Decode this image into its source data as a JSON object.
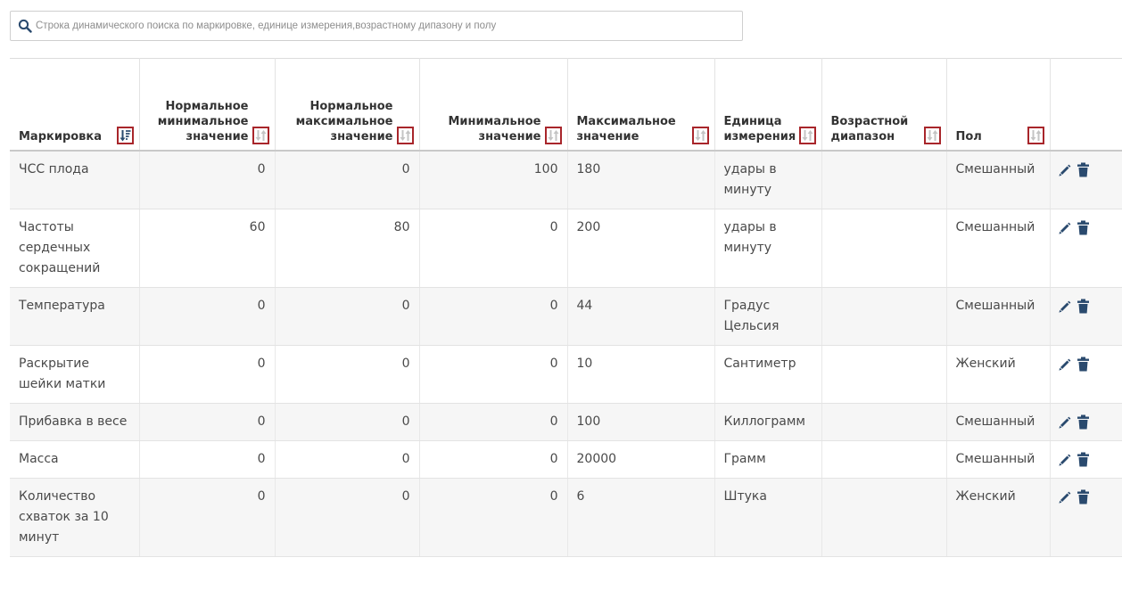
{
  "search": {
    "placeholder": "Строка динамического поиска по маркировке, единице измерения,возрастному дипазону и полу"
  },
  "colors": {
    "accent": "#2a4a6e",
    "sort_highlight": "#a8262b",
    "row_alt": "#f6f6f6"
  },
  "icons": {
    "search": "search-icon",
    "sort": "sort-icon",
    "edit": "pencil-icon",
    "delete": "trash-icon"
  },
  "columns": {
    "marking": "Маркировка",
    "normal_min": "Нормальное минимальное значение",
    "normal_max": "Нормальное максимальное значение",
    "min": "Минимальное значение",
    "max": "Максимальное значение",
    "unit": "Единица измерения",
    "age_range": "Возрастной диапазон",
    "sex": "Пол"
  },
  "rows": [
    {
      "marking": "ЧСС плода",
      "normal_min": "0",
      "normal_max": "0",
      "min": "100",
      "max": "180",
      "unit": "удары в минуту",
      "age_range": "",
      "sex": "Смешанный"
    },
    {
      "marking": "Частоты сердечных сокращений",
      "normal_min": "60",
      "normal_max": "80",
      "min": "0",
      "max": "200",
      "unit": "удары в минуту",
      "age_range": "",
      "sex": "Смешанный"
    },
    {
      "marking": "Температура",
      "normal_min": "0",
      "normal_max": "0",
      "min": "0",
      "max": "44",
      "unit": "Градус Цельсия",
      "age_range": "",
      "sex": "Смешанный"
    },
    {
      "marking": "Раскрытие шейки матки",
      "normal_min": "0",
      "normal_max": "0",
      "min": "0",
      "max": "10",
      "unit": "Сантиметр",
      "age_range": "",
      "sex": "Женский"
    },
    {
      "marking": "Прибавка в весе",
      "normal_min": "0",
      "normal_max": "0",
      "min": "0",
      "max": "100",
      "unit": "Киллограмм",
      "age_range": "",
      "sex": "Смешанный"
    },
    {
      "marking": "Масса",
      "normal_min": "0",
      "normal_max": "0",
      "min": "0",
      "max": "20000",
      "unit": "Грамм",
      "age_range": "",
      "sex": "Смешанный"
    },
    {
      "marking": "Количество схваток за 10 минут",
      "normal_min": "0",
      "normal_max": "0",
      "min": "0",
      "max": "6",
      "unit": "Штука",
      "age_range": "",
      "sex": "Женский"
    }
  ]
}
